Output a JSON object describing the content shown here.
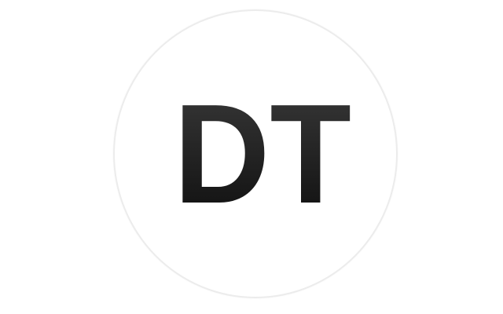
{
  "logo": {
    "initials": "DT",
    "text_color_top": "#3a3a3a",
    "text_color_bottom": "#0d0d0d",
    "circle_fill": "#ffffff",
    "circle_border": "#ececec",
    "background": "#ffffff"
  }
}
